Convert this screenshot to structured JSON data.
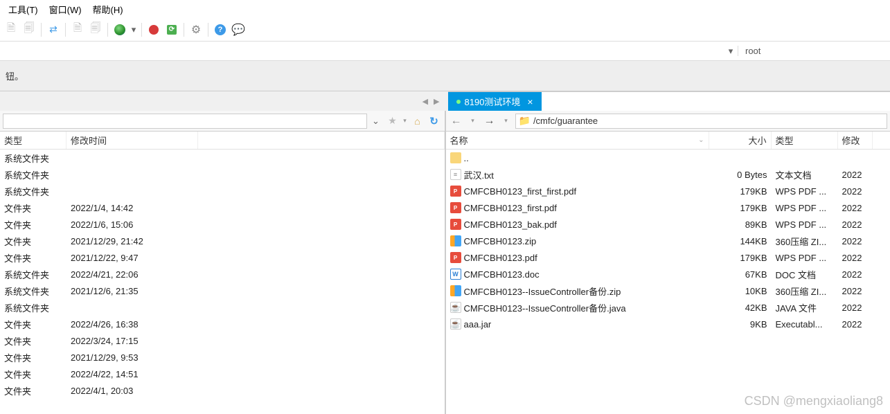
{
  "menu": {
    "tools": "工具(T)",
    "window": "窗口(W)",
    "help": "帮助(H)"
  },
  "toolbar": {},
  "user_field": "root",
  "info_text": "钮。",
  "remote_tab": {
    "label": "8190测试环境"
  },
  "remote_path": "/cmfc/guarantee",
  "left_headers": {
    "type": "类型",
    "modified": "修改时间"
  },
  "right_headers": {
    "name": "名称",
    "size": "大小",
    "type": "类型",
    "modified": "修改"
  },
  "left_rows": [
    {
      "type": "系统文件夹",
      "date": ""
    },
    {
      "type": "系统文件夹",
      "date": ""
    },
    {
      "type": "系统文件夹",
      "date": ""
    },
    {
      "type": "文件夹",
      "date": "2022/1/4, 14:42"
    },
    {
      "type": "文件夹",
      "date": "2022/1/6, 15:06"
    },
    {
      "type": "文件夹",
      "date": "2021/12/29, 21:42"
    },
    {
      "type": "文件夹",
      "date": "2021/12/22, 9:47"
    },
    {
      "type": "系统文件夹",
      "date": "2022/4/21, 22:06"
    },
    {
      "type": "系统文件夹",
      "date": "2021/12/6, 21:35"
    },
    {
      "type": "系统文件夹",
      "date": ""
    },
    {
      "type": "文件夹",
      "date": "2022/4/26, 16:38"
    },
    {
      "type": "文件夹",
      "date": "2022/3/24, 17:15"
    },
    {
      "type": "文件夹",
      "date": "2021/12/29, 9:53"
    },
    {
      "type": "文件夹",
      "date": "2022/4/22, 14:51"
    },
    {
      "type": "文件夹",
      "date": "2022/4/1, 20:03"
    }
  ],
  "right_rows": [
    {
      "icon": "folder",
      "name": "..",
      "size": "",
      "type": "",
      "mod": ""
    },
    {
      "icon": "txt",
      "name": "武汉.txt",
      "size": "0 Bytes",
      "type": "文本文档",
      "mod": "2022"
    },
    {
      "icon": "pdf",
      "name": "CMFCBH0123_first_first.pdf",
      "size": "179KB",
      "type": "WPS PDF ...",
      "mod": "2022"
    },
    {
      "icon": "pdf",
      "name": "CMFCBH0123_first.pdf",
      "size": "179KB",
      "type": "WPS PDF ...",
      "mod": "2022"
    },
    {
      "icon": "pdf",
      "name": "CMFCBH0123_bak.pdf",
      "size": "89KB",
      "type": "WPS PDF ...",
      "mod": "2022"
    },
    {
      "icon": "zip",
      "name": "CMFCBH0123.zip",
      "size": "144KB",
      "type": "360压缩 ZI...",
      "mod": "2022"
    },
    {
      "icon": "pdf",
      "name": "CMFCBH0123.pdf",
      "size": "179KB",
      "type": "WPS PDF ...",
      "mod": "2022"
    },
    {
      "icon": "doc",
      "name": "CMFCBH0123.doc",
      "size": "67KB",
      "type": "DOC 文档",
      "mod": "2022"
    },
    {
      "icon": "zip",
      "name": "CMFCBH0123--IssueController备份.zip",
      "size": "10KB",
      "type": "360压缩 ZI...",
      "mod": "2022"
    },
    {
      "icon": "java",
      "name": "CMFCBH0123--IssueController备份.java",
      "size": "42KB",
      "type": "JAVA 文件",
      "mod": "2022"
    },
    {
      "icon": "jar",
      "name": "aaa.jar",
      "size": "9KB",
      "type": "Executabl...",
      "mod": "2022"
    }
  ],
  "watermark": "CSDN @mengxiaoliang8"
}
